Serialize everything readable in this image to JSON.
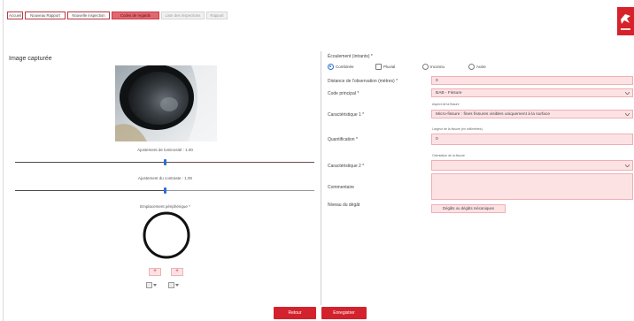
{
  "nav": {
    "tabs": [
      {
        "label": "Accueil",
        "active": false,
        "disabled": false
      },
      {
        "label": "Nouveau Rapport",
        "active": false,
        "disabled": false
      },
      {
        "label": "Nouvelle inspection",
        "active": false,
        "disabled": false
      },
      {
        "label": "Codes de regards",
        "active": true,
        "disabled": false
      },
      {
        "label": "Liste des inspections",
        "active": false,
        "disabled": true
      },
      {
        "label": "Rapport",
        "active": false,
        "disabled": true
      }
    ]
  },
  "logo": {
    "icon": "brand-logo-icon"
  },
  "capture": {
    "title": "Image capturée",
    "brightness": {
      "label": "Ajustement de luminosité : 1.00",
      "level": 0.5
    },
    "contrast": {
      "label": "Ajustement du contraste : 1.00",
      "level": 0.5
    },
    "location": {
      "label": "Emplacement périphérique *",
      "buttons": [
        "+",
        "+"
      ],
      "selectors": [
        {
          "icon": "grid-select-icon"
        },
        {
          "icon": "grid-select-icon"
        }
      ]
    }
  },
  "form": {
    "flow": {
      "label": "Écoulement (intrants) *",
      "options": [
        {
          "label": "Combinée",
          "icon": "radio-checked-icon",
          "selected": true
        },
        {
          "label": "Pluvial",
          "icon": "checkbox-icon",
          "selected": false
        },
        {
          "label": "Inconnu",
          "icon": "radio-icon",
          "selected": false
        },
        {
          "label": "Autre",
          "icon": "radio-icon",
          "selected": false
        }
      ]
    },
    "distance": {
      "label": "Distance de l'observation (mètres) *",
      "value": "0"
    },
    "main_code": {
      "label": "Code principal *",
      "value": "BAB - Fissure",
      "icon": "chevron-down-icon"
    },
    "char1": {
      "label": "Caractéristique 1 *",
      "hint": "Aspect de la fissure",
      "value": "Micro-fissure : fines fissures visibles uniquement à la surface",
      "icon": "chevron-down-icon"
    },
    "quantification": {
      "label": "Quantification *",
      "hint": "Largeur de la fissure (en millimètres)",
      "value": "0"
    },
    "char2": {
      "label": "Caractéristique 2 *",
      "hint": "Orientation de la fissure",
      "value": "",
      "icon": "chevron-down-icon"
    },
    "comment": {
      "label": "Commentaire",
      "value": ""
    },
    "damage": {
      "label": "Niveau du dégât",
      "button": "Dégâts ou dégâts mécaniques"
    }
  },
  "footer": {
    "back_label": "Retour",
    "save_label": "Enregistrer"
  },
  "colors": {
    "accent": "#d3222d",
    "field_bg": "#fde2e4",
    "field_border": "#efb0b5",
    "radio": "#2b6fd4",
    "tab_active": "#e4676f"
  }
}
